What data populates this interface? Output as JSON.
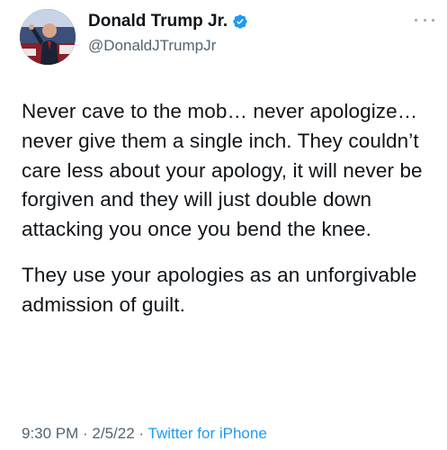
{
  "author": {
    "display_name": "Donald Trump Jr.",
    "handle": "@DonaldJTrumpJr",
    "verified": true,
    "verified_color": "#1d9bf0"
  },
  "tweet": {
    "paragraph_1": "Never cave to the mob… never apologize… never give them a single inch. They couldn’t care less about your apology, it will never be forgiven and they will just double down attacking you once you bend the knee.",
    "paragraph_2": "They use your apologies as an unforgivable admission of guilt."
  },
  "meta": {
    "time": "9:30 PM",
    "separator": " · ",
    "date": "2/5/22",
    "source": "Twitter for iPhone"
  },
  "icons": {
    "more": "more-horizontal-icon",
    "verified": "verified-badge-icon"
  },
  "colors": {
    "text": "#0f1419",
    "secondary": "#536471",
    "link": "#1d9bf0"
  }
}
